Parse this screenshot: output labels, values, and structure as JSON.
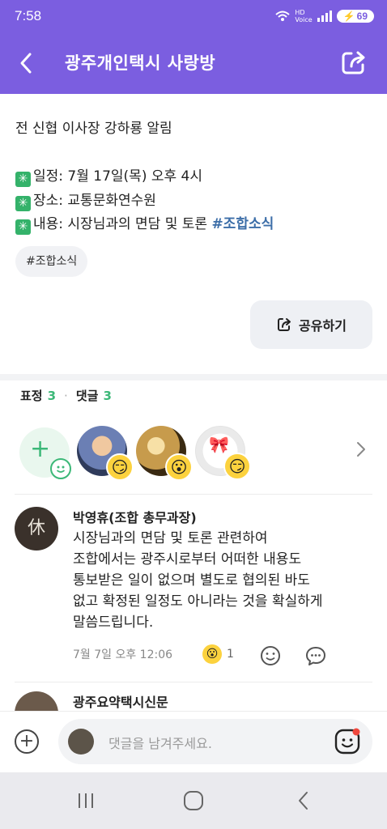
{
  "status_bar": {
    "time": "7:58",
    "hd_label": "HD",
    "voice_label": "Voice",
    "battery": "69"
  },
  "app_bar": {
    "title": "광주개인택시 사랑방"
  },
  "post": {
    "line1": "전 신협 이사장 강하룡 알림",
    "schedule": "일정: 7월 17일(목) 오후 4시",
    "place": "장소: 교통문화연수원",
    "content_prefix": "내용: 시장님과의 면담 및 토론 ",
    "content_hashtag": "#조합소식",
    "tag_chip": "#조합소식",
    "share_label": "공유하기"
  },
  "counts": {
    "reactions_label": "표정",
    "reactions_count": "3",
    "comments_label": "댓글",
    "comments_count": "3"
  },
  "comments": [
    {
      "author": "박영휴(조합 총무과장)",
      "body_lines": [
        "시장님과의 면담 및 토론 관련하여",
        "조합에서는 광주시로부터 어떠한 내용도",
        "통보받은 일이 없으며 별도로 협의된 바도",
        "없고 확정된 일정도 아니라는 것을 확실하게",
        "말씀드립니다."
      ],
      "avatar_char": "休",
      "time": "7월 7일 오후 12:06",
      "reaction_count": "1"
    },
    {
      "author": "광주요약택시신문"
    }
  ],
  "input": {
    "placeholder": "댓글을 남겨주세요."
  },
  "colors": {
    "brand": "#7b5ee0",
    "accent_green": "#3cb878",
    "hashtag": "#3c6ea8"
  },
  "icons": [
    "back-icon",
    "share-icon",
    "sparkle-icon",
    "add-reaction-icon",
    "chevron-right-icon",
    "smiley-icon",
    "comment-icon",
    "plus-icon",
    "emoji-icon",
    "recents-icon",
    "home-icon",
    "nav-back-icon"
  ]
}
